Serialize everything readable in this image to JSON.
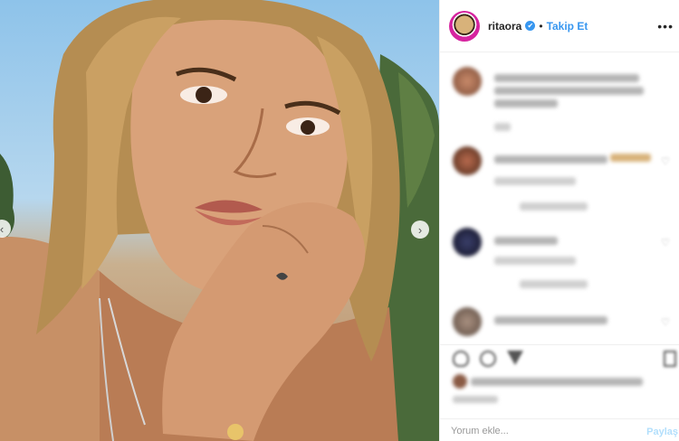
{
  "post": {
    "username": "ritaora",
    "follow_label": "Takip Et",
    "more_label": "•••",
    "verified_icon": "✔",
    "separator": "•"
  },
  "photo": {
    "prev_arrow": "‹",
    "next_arrow": "›"
  },
  "comment_box": {
    "placeholder": "Yorum ekle...",
    "post_label": "Paylaş"
  },
  "colors": {
    "accent": "#3897f0",
    "story_ring": "#d6249f",
    "border": "#efefef"
  },
  "icons": [
    "heart-icon",
    "comment-icon",
    "share-icon",
    "bookmark-icon"
  ]
}
